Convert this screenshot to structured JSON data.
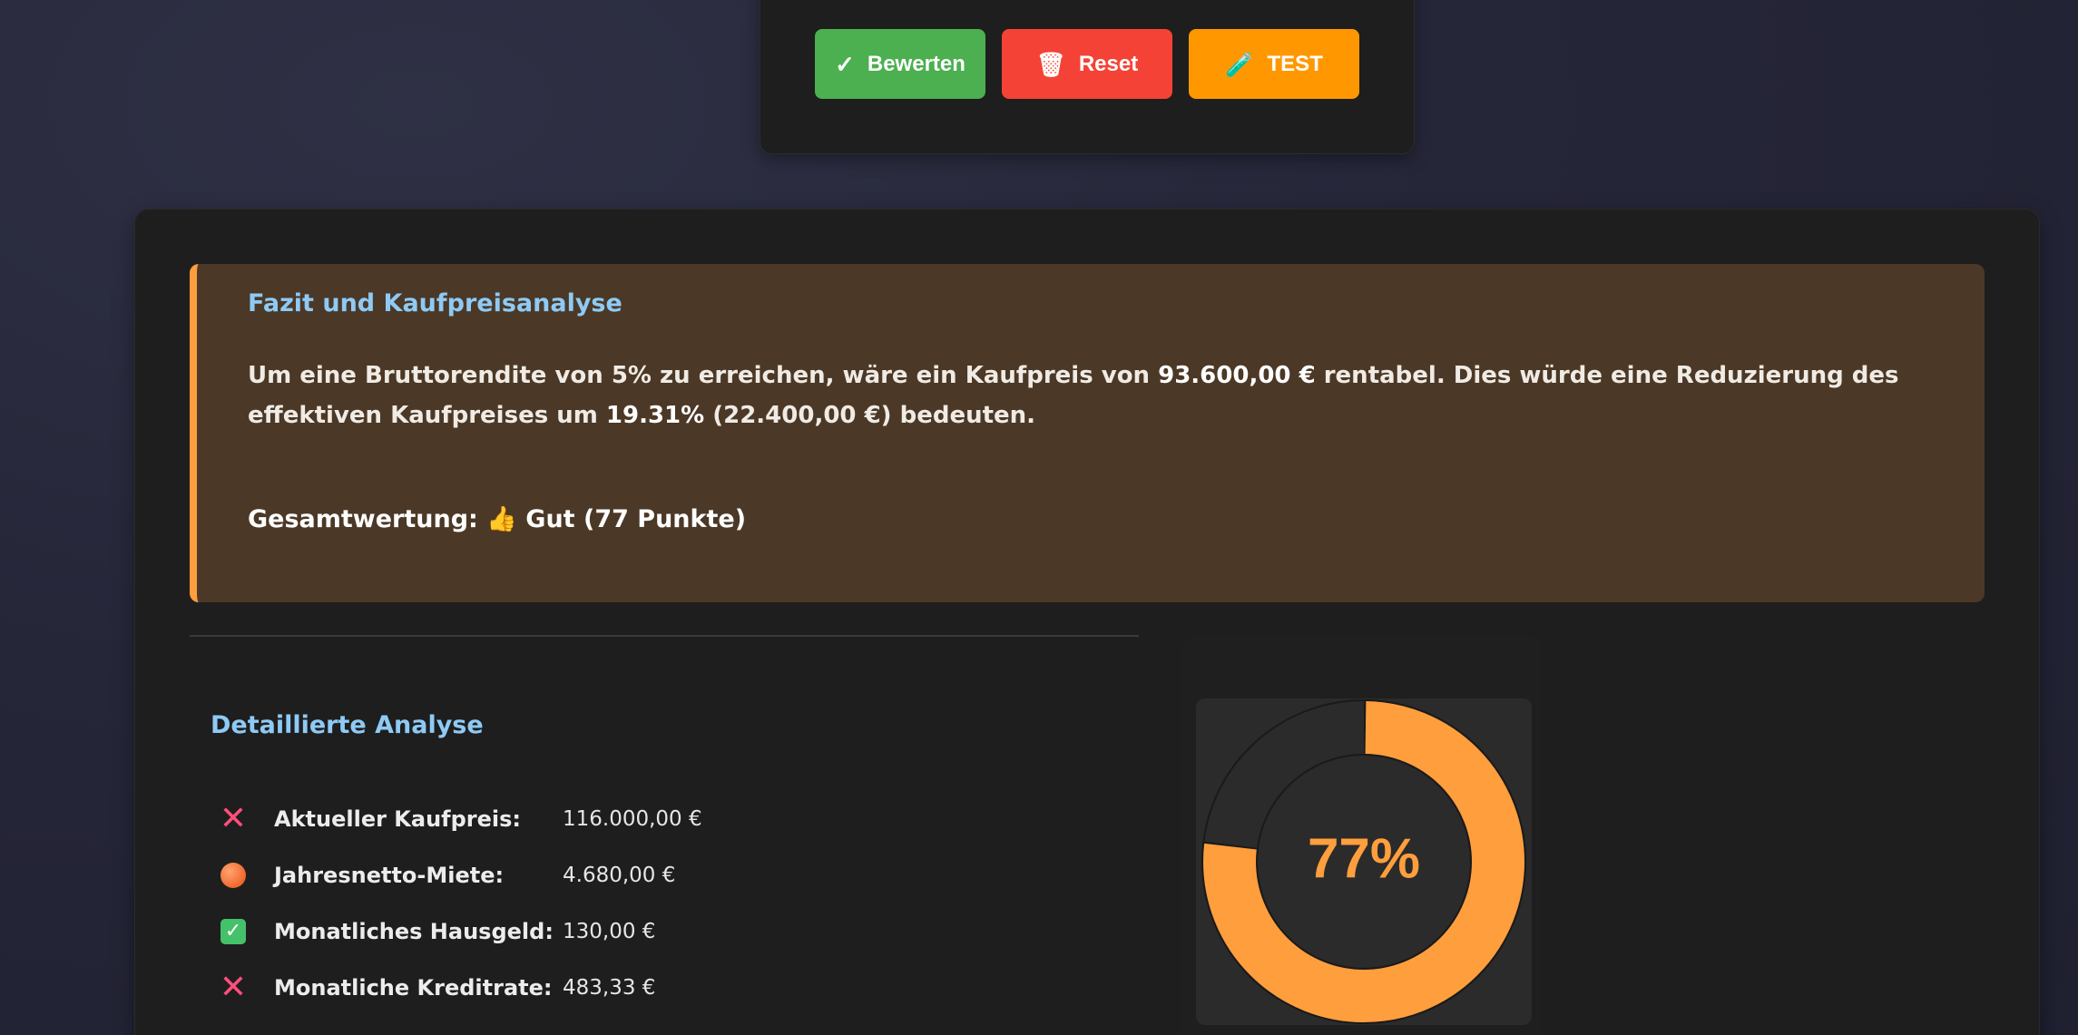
{
  "buttons": {
    "evaluate": {
      "icon": "✓",
      "label": "Bewerten"
    },
    "reset": {
      "icon": "🗑",
      "label": "Reset"
    },
    "test": {
      "icon": "🧪",
      "label": "TEST"
    }
  },
  "fazit": {
    "title": "Fazit und Kaufpreisanalyse",
    "text_part1": "Um eine Bruttorendite von 5% zu erreichen, wäre ein Kaufpreis von ",
    "target_price": "93.600,00 €",
    "text_part2": " rentabel. Dies würde eine Reduzierung des effektiven Kaufpreises um ",
    "reduction_percent": "19.31%",
    "text_part3": " (22.400,00 €) bedeuten.",
    "score_label": "Gesamtwertung:",
    "score_icon": "👍",
    "score_text": "Gut (77 Punkte)"
  },
  "details": {
    "title": "Detaillierte Analyse",
    "rows": [
      {
        "icon": "cross",
        "label": "Aktueller Kaufpreis:",
        "value": "116.000,00 €"
      },
      {
        "icon": "orange-dot",
        "label": "Jahresnetto-Miete:",
        "value": "4.680,00 €"
      },
      {
        "icon": "check",
        "label": "Monatliches Hausgeld:",
        "value": "130,00 €"
      },
      {
        "icon": "cross",
        "label": "Monatliche Kreditrate:",
        "value": "483,33 €"
      }
    ]
  },
  "score_gauge": {
    "value": 77,
    "label": "77%",
    "fill_color": "#ff9e3d",
    "track_color": "#2b2b2b"
  }
}
